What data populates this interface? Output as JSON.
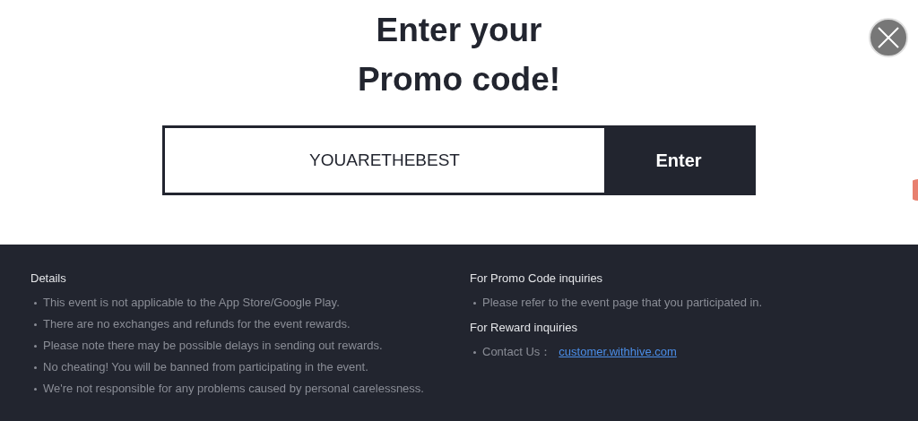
{
  "title_lines": [
    "Enter your",
    "Promo code!"
  ],
  "promo_field": {
    "value": "YOUARETHEBEST"
  },
  "enter_button": "Enter",
  "details": {
    "heading": "Details",
    "items": [
      "This event is not applicable to the App Store/Google Play.",
      "There are no exchanges and refunds for the event rewards.",
      "Please note there may be possible delays in sending out rewards.",
      "No cheating! You will be banned from participating in the event.",
      "We're not responsible for any problems caused by personal carelessness."
    ]
  },
  "inquiries": [
    {
      "heading": "For Promo Code inquiries",
      "items": [
        {
          "text": "Please refer to the event page that you participated in."
        }
      ]
    },
    {
      "heading": "For Reward inquiries",
      "items": [
        {
          "text": "Contact Us：",
          "link": "customer.withhive.com"
        }
      ]
    }
  ]
}
